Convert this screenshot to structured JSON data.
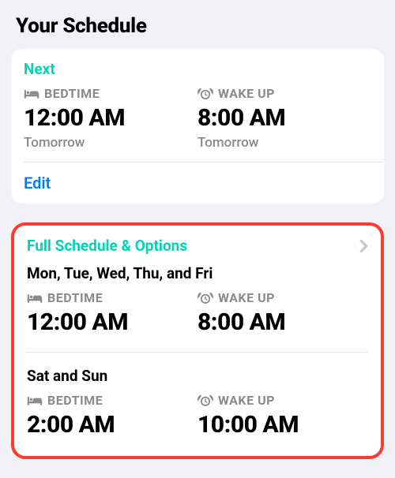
{
  "title": "Your Schedule",
  "next_card": {
    "header": "Next",
    "bedtime": {
      "label": "BEDTIME",
      "time": "12:00 AM",
      "sub": "Tomorrow"
    },
    "wakeup": {
      "label": "WAKE UP",
      "time": "8:00 AM",
      "sub": "Tomorrow"
    },
    "edit": "Edit"
  },
  "full_card": {
    "header": "Full Schedule & Options",
    "schedules": [
      {
        "days": "Mon, Tue, Wed, Thu, and Fri",
        "bedtime": {
          "label": "BEDTIME",
          "time": "12:00 AM"
        },
        "wakeup": {
          "label": "WAKE UP",
          "time": "8:00 AM"
        }
      },
      {
        "days": "Sat and Sun",
        "bedtime": {
          "label": "BEDTIME",
          "time": "2:00 AM"
        },
        "wakeup": {
          "label": "WAKE UP",
          "time": "10:00 AM"
        }
      }
    ]
  },
  "colors": {
    "accent": "#00d3b7",
    "link": "#007aff",
    "highlight": "#ff3b30"
  }
}
